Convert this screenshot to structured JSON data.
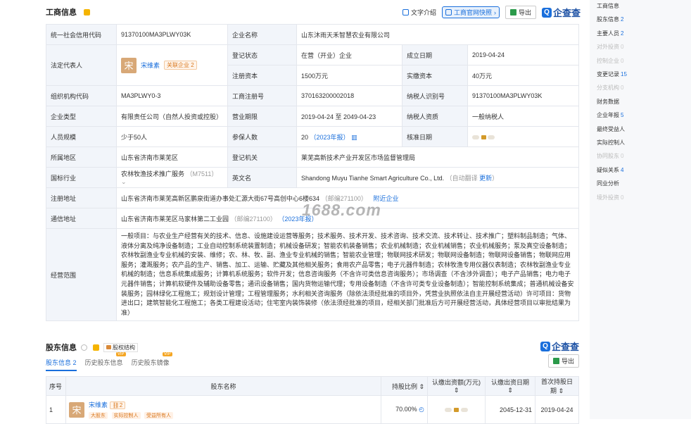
{
  "header": {
    "title": "工商信息",
    "text_intro": "文字介绍",
    "quick_snapshot": "工商官网快照",
    "export": "导出",
    "brand": "企查查",
    "brand_mark": "Q"
  },
  "info": {
    "credit_code_label": "统一社会信用代码",
    "credit_code": "91370100MA3PLWY03K",
    "company_name_label": "企业名称",
    "company_name": "山东沐雨天禾智慧农业有限公司",
    "legal_rep_label": "法定代表人",
    "legal_rep_avatar": "宋",
    "legal_rep_name": "宋维素",
    "related_company": "关联企业 2",
    "reg_status_label": "登记状态",
    "reg_status": "在营（开业）企业",
    "found_date_label": "成立日期",
    "found_date": "2019-04-24",
    "reg_capital_label": "注册资本",
    "reg_capital": "1500万元",
    "paid_capital_label": "实缴资本",
    "paid_capital": "40万元",
    "org_code_label": "组织机构代码",
    "org_code": "MA3PLWY0-3",
    "reg_no_label": "工商注册号",
    "reg_no": "370163200002018",
    "taxpayer_id_label": "纳税人识别号",
    "taxpayer_id": "91370100MA3PLWY03K",
    "company_type_label": "企业类型",
    "company_type": "有限责任公司（自然人投资或控股）",
    "term_label": "营业期限",
    "term": "2019-04-24 至 2049-04-23",
    "taxpayer_quality_label": "纳税人资质",
    "taxpayer_quality": "一般纳税人",
    "staff_size_label": "人员规模",
    "staff_size": "少于50人",
    "insured_label": "参保人数",
    "insured": "20",
    "insured_year": "（2023年报）",
    "approval_date_label": "核准日期",
    "region_label": "所属地区",
    "region": "山东省济南市莱芜区",
    "reg_authority_label": "登记机关",
    "reg_authority": "莱芜高新技术产业开发区市场监督管理局",
    "industry_label": "国标行业",
    "industry": "农林牧渔技术推广服务",
    "industry_code": "（M7511）",
    "english_name_label": "英文名",
    "english_name": "Shandong Muyu Tianhe Smart Agriculture Co., Ltd.",
    "auto_translate": "（自动翻译 ",
    "update": "更新",
    "auto_translate_end": "）",
    "reg_address_label": "注册地址",
    "reg_address": "山东省济南市莱芜高新区鹏泉街道办事处汇源大街67号高创中心6楼634",
    "reg_postcode": "（邮编271100）",
    "nearby": "附近企业",
    "mail_address_label": "通信地址",
    "mail_address": "山东省济南市莱芜区马家林第二工业园",
    "mail_postcode": "（邮编271100）",
    "mail_year": "（2023年报）",
    "scope_label": "经营范围",
    "scope": "一般项目：与农业生产经营有关的技术、信息、设施建设运营等服务；技术服务、技术开发、技术咨询、技术交流、技术转让、技术推广；塑料制品制造；气体、液体分离及纯净设备制造；工业自动控制系统装置制造；机械设备研发；智能农机装备销售；农业机械制造；农业机械销售；农业机械服务；泵及真空设备制造；农林牧副渔业专业机械的安装、维修；农、林、牧、副、渔业专业机械的销售；智能农业管理；物联网技术研发；物联网设备制造；物联网设备销售；物联网应用服务；灌溉服务；农产品的生产、销售、加工、运输、贮藏及其他相关服务；食用农产品零售；电子元器件制造；农林牧渔专用仪器仪表制造；农林牧副渔业专业机械的制造；信息系统集成服务；计算机系统服务；软件开发；信息咨询服务（不含许可类信息咨询服务）；市场调查（不含涉外调查）；电子产品销售；电力电子元器件销售；计算机软硬件及辅助设备零售；通讯设备销售；国内货物运输代理；专用设备制造（不含许可类专业设备制造）；智能控制系统集成；普通机械设备安装服务；园林绿化工程施工；规划设计管理；工程管理服务；水利相关咨询服务（除依法须经批准的项目外，凭营业执照依法自主开展经营活动）许可项目：货物进出口；建筑智能化工程施工；各类工程建设活动；住宅室内装饰装修（依法须经批准的项目，经相关部门批准后方可开展经营活动，具体经营项目以审批结果为准）"
  },
  "watermark": "1688.com",
  "shareholders": {
    "title": "股东信息",
    "equity_structure": "股权结构",
    "brand": "企查查",
    "brand_mark": "Q",
    "export": "导出",
    "tabs": [
      {
        "label": "股东信息",
        "count": "2"
      },
      {
        "label": "历史股东信息",
        "badge": "VIP"
      },
      {
        "label": "历史股东镜像",
        "badge": "VIP"
      }
    ],
    "columns": [
      "序号",
      "股东名称",
      "持股比例",
      "认缴出资额(万元)",
      "认缴出资日期",
      "首次持股日期"
    ],
    "rows": [
      {
        "index": "1",
        "avatar": "宋",
        "name": "宋维素",
        "related": "2",
        "tags": [
          "大股东",
          "实际控制人",
          "受益所有人"
        ],
        "ratio": "70.00%",
        "sub_date": "2045-12-31",
        "first_date": "2019-04-24"
      }
    ]
  },
  "sidebar": {
    "items": [
      {
        "label": "工商信息",
        "count": "",
        "enabled": true
      },
      {
        "label": "股东信息",
        "count": "2",
        "enabled": true
      },
      {
        "label": "主要人员",
        "count": "2",
        "enabled": true
      },
      {
        "label": "对外投资",
        "count": "0",
        "enabled": false
      },
      {
        "label": "控制企业",
        "count": "0",
        "enabled": false
      },
      {
        "label": "变更记录",
        "count": "15",
        "enabled": true
      },
      {
        "label": "分支机构",
        "count": "0",
        "enabled": false
      },
      {
        "label": "财务数据",
        "count": "",
        "enabled": true
      },
      {
        "label": "企业年报",
        "count": "5",
        "enabled": true
      },
      {
        "label": "最终受益人",
        "count": "",
        "enabled": true
      },
      {
        "label": "实际控制人",
        "count": "",
        "enabled": true
      },
      {
        "label": "协同股东",
        "count": "0",
        "enabled": false
      },
      {
        "label": "疑似关系",
        "count": "4",
        "enabled": true
      },
      {
        "label": "同业分析",
        "count": "",
        "enabled": true
      },
      {
        "label": "境外投资",
        "count": "0",
        "enabled": false
      }
    ]
  }
}
